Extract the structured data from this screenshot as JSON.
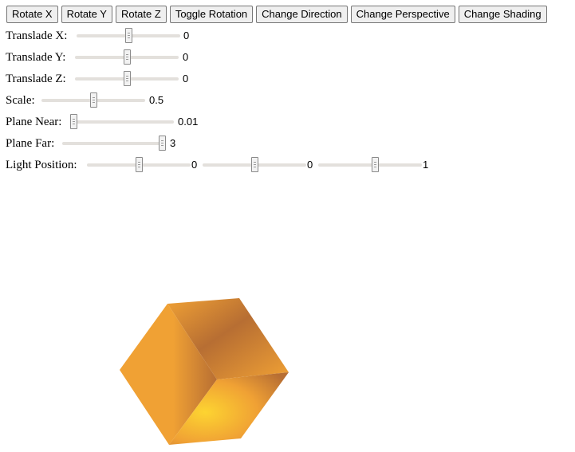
{
  "toolbar": {
    "rotate_x": "Rotate X",
    "rotate_y": "Rotate Y",
    "rotate_z": "Rotate Z",
    "toggle_rotation": "Toggle Rotation",
    "change_direction": "Change Direction",
    "change_perspective": "Change Perspective",
    "change_shading": "Change Shading"
  },
  "controls": {
    "translate_x": {
      "label": "Translade X:",
      "value": "0",
      "level": 0.5
    },
    "translate_y": {
      "label": "Translade Y:",
      "value": "0",
      "level": 0.5
    },
    "translate_z": {
      "label": "Translade Z:",
      "value": "0",
      "level": 0.5
    },
    "scale": {
      "label": "Scale:",
      "value": "0.5",
      "level": 0.5
    },
    "plane_near": {
      "label": "Plane Near:",
      "value": "0.01",
      "level": 0
    },
    "plane_far": {
      "label": "Plane Far:",
      "value": "3",
      "level": 1
    },
    "light_position": {
      "label": "Light Position:",
      "x": {
        "value": "0",
        "level": 0.5
      },
      "y": {
        "value": "0",
        "level": 0.5
      },
      "z": {
        "value": "1",
        "level": 0.55
      }
    }
  },
  "colors": {
    "cube_highlight": "#fdd431",
    "cube_mid": "#f0a134",
    "cube_shadow": "#b76e33",
    "slider_track": "#e3e0dc"
  }
}
